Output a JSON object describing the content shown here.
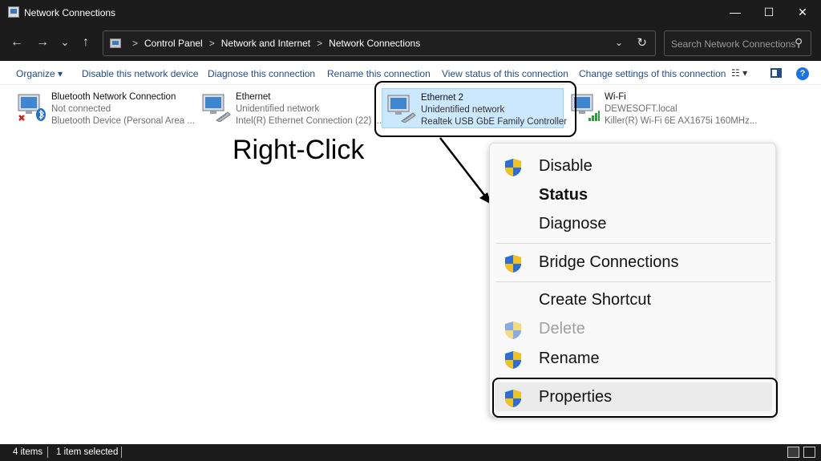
{
  "window": {
    "title": "Network Connections"
  },
  "titlebar_buttons": {
    "minimize": "—",
    "maximize": "☐",
    "close": "✕"
  },
  "nav": {
    "back": "←",
    "forward": "→",
    "recent": "⌄",
    "up": "↑"
  },
  "breadcrumb": [
    "Control Panel",
    "Network and Internet",
    "Network Connections"
  ],
  "breadcrumb_sep": ">",
  "address": {
    "dropdown": "⌄",
    "refresh": "↻"
  },
  "search": {
    "placeholder": "Search Network Connections",
    "icon": "⚲"
  },
  "toolbar": {
    "organize": "Organize ▾",
    "disable": "Disable this network device",
    "diagnose": "Diagnose this connection",
    "rename": "Rename this connection",
    "view_status": "View status of this connection",
    "change_settings": "Change settings of this connection",
    "view_options": "☷ ▾",
    "help": "?"
  },
  "connections": [
    {
      "name": "Bluetooth Network Connection",
      "status": "Not connected",
      "device": "Bluetooth Device (Personal Area ...",
      "icon": "network-adapter-bluetooth-icon",
      "selected": false
    },
    {
      "name": "Ethernet",
      "status": "Unidentified network",
      "device": "Intel(R) Ethernet Connection (22) ...",
      "icon": "network-adapter-ethernet-icon",
      "selected": false
    },
    {
      "name": "Ethernet 2",
      "status": "Unidentified network",
      "device": "Realtek USB GbE Family Controller",
      "icon": "network-adapter-ethernet-icon",
      "selected": true
    },
    {
      "name": "Wi-Fi",
      "status": "DEWESOFT.local",
      "device": "Killer(R) Wi-Fi 6E AX1675i 160MHz...",
      "icon": "network-adapter-wifi-icon",
      "selected": false
    }
  ],
  "annotation": {
    "right_click": "Right-Click"
  },
  "context_menu": {
    "items": [
      {
        "label": "Disable",
        "shield": true,
        "bold": false,
        "disabled": false
      },
      {
        "label": "Status",
        "shield": false,
        "bold": true,
        "disabled": false
      },
      {
        "label": "Diagnose",
        "shield": false,
        "bold": false,
        "disabled": false
      },
      {
        "label": "Bridge Connections",
        "shield": true,
        "bold": false,
        "disabled": false
      },
      {
        "label": "Create Shortcut",
        "shield": false,
        "bold": false,
        "disabled": false
      },
      {
        "label": "Delete",
        "shield": true,
        "bold": false,
        "disabled": true
      },
      {
        "label": "Rename",
        "shield": true,
        "bold": false,
        "disabled": false
      },
      {
        "label": "Properties",
        "shield": true,
        "bold": false,
        "disabled": false,
        "highlighted": true
      }
    ]
  },
  "statusbar": {
    "count": "4 items",
    "selected": "1 item selected"
  },
  "colors": {
    "titlebar": "#1c1c1c",
    "link": "#1f4e8c",
    "selection": "#cce8ff",
    "shield_blue": "#2b6fd6",
    "shield_yellow": "#f2c21b"
  }
}
